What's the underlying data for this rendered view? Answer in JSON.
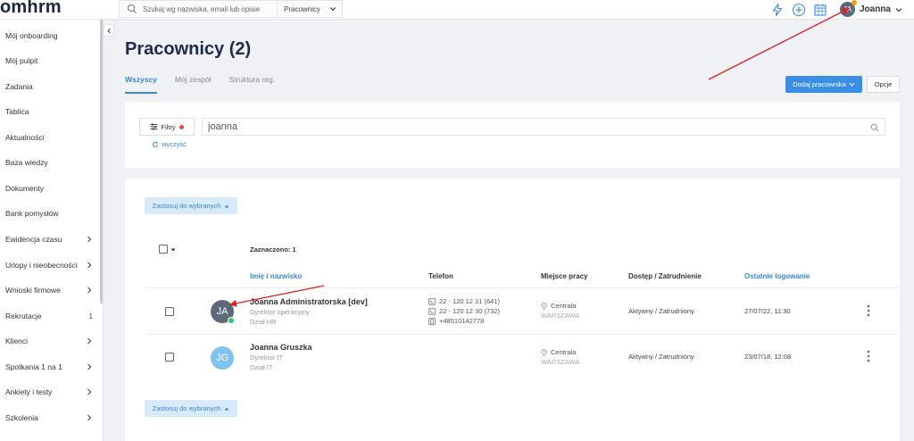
{
  "app": {
    "logo": "omhrm"
  },
  "search": {
    "placeholder": "Szukaj wg nazwiska, email lub opisie",
    "scope": "Pracownicy"
  },
  "user": {
    "initials": "JA",
    "name": "Joanna"
  },
  "sidebar": {
    "items": [
      {
        "label": "Mój onboarding",
        "chevron": false,
        "count": ""
      },
      {
        "label": "Mój pulpit",
        "chevron": false,
        "count": ""
      },
      {
        "label": "Zadania",
        "chevron": false,
        "count": ""
      },
      {
        "label": "Tablica",
        "chevron": false,
        "count": ""
      },
      {
        "label": "Aktualności",
        "chevron": false,
        "count": ""
      },
      {
        "label": "Baza wiedzy",
        "chevron": false,
        "count": ""
      },
      {
        "label": "Dokumenty",
        "chevron": false,
        "count": ""
      },
      {
        "label": "Bank pomysłów",
        "chevron": false,
        "count": ""
      },
      {
        "label": "Ewidencja czasu",
        "chevron": true,
        "count": ""
      },
      {
        "label": "Urlopy i nieobecności",
        "chevron": true,
        "count": ""
      },
      {
        "label": "Wnioski firmowe",
        "chevron": true,
        "count": ""
      },
      {
        "label": "Rekrutacje",
        "chevron": false,
        "count": "1"
      },
      {
        "label": "Klienci",
        "chevron": true,
        "count": ""
      },
      {
        "label": "Spotkania 1 na 1",
        "chevron": true,
        "count": ""
      },
      {
        "label": "Ankiety i testy",
        "chevron": true,
        "count": ""
      },
      {
        "label": "Szkolenia",
        "chevron": true,
        "count": ""
      }
    ]
  },
  "page": {
    "title": "Pracownicy (2)"
  },
  "tabs": [
    {
      "label": "Wszyscy",
      "active": true
    },
    {
      "label": "Mój zespół",
      "active": false
    },
    {
      "label": "Struktura org.",
      "active": false
    }
  ],
  "actions": {
    "add_employee": "Dodaj pracownika",
    "options": "Opcje"
  },
  "filters": {
    "button": "Filtry",
    "query": "joanna",
    "clear": "wyczyść"
  },
  "table": {
    "apply_label": "Zastosuj do wybranych",
    "selected_label": "Zaznaczono: 1",
    "headers": {
      "name": "Imię i nazwisko",
      "phone": "Telefon",
      "workplace": "Miejsce pracy",
      "access": "Dostęp / Zatrudnienie",
      "last_login": "Ostatnie logowanie"
    },
    "rows": [
      {
        "initials": "JA",
        "avatar_color": "#5b6a7a",
        "online": true,
        "name": "Joanna Administratorska [dev]",
        "position": "Dyrektor operacyjny",
        "department": "Dział HR",
        "phones": [
          "22 - 120 12 31 (641)",
          "22 - 120 12 30 (732)",
          "+48510142778"
        ],
        "location": "Centrala",
        "city": "WARSZAWA",
        "access": "Aktywny / Zatrudniony",
        "last_login": "27/07/22, 11:30"
      },
      {
        "initials": "JG",
        "avatar_color": "#7fc4ef",
        "online": false,
        "name": "Joanna Gruszka",
        "position": "Dyrektor IT",
        "department": "Dział IT",
        "phones": [],
        "location": "Centrala",
        "city": "WARSZAWA",
        "access": "Aktywny / Zatrudniony",
        "last_login": "23/07/18, 12:08"
      }
    ]
  },
  "colors": {
    "accent": "#3a8ee6",
    "title": "#1c2a50",
    "annotation": "#e02020"
  }
}
